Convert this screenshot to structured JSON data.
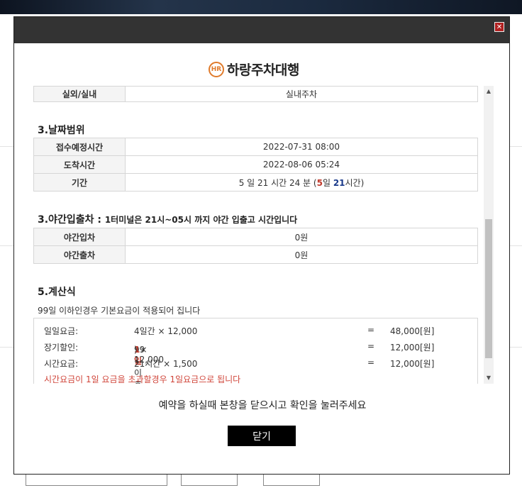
{
  "brand": {
    "logo_mark": "HR",
    "name": "하랑주차대행"
  },
  "colors": {
    "header_bar": "#333333",
    "accent_orange": "#e07a2a",
    "navy": "#1a3a8a",
    "red": "#c0392b",
    "button": "#000000"
  },
  "top_row": {
    "key": "실외/실내",
    "value": "실내주차"
  },
  "section_date": {
    "title": "3.날짜범위",
    "rows": [
      {
        "key": "접수예정시간",
        "value": "2022-07-31 08:00"
      },
      {
        "key": "도착시간",
        "value": "2022-08-06 05:24"
      }
    ],
    "period": {
      "key": "기간",
      "prefix": "5 일 21 시간 24 분 (",
      "days": "5",
      "days_unit": "일 ",
      "hours": "21",
      "hours_unit": "시간",
      "suffix": ")"
    }
  },
  "section_night": {
    "title": "3.야간입출차 :",
    "note": "1터미널은 21시~05시 까지 야간 입출고 시간입니다",
    "rows": [
      {
        "key": "야간입차",
        "value": "0원"
      },
      {
        "key": "야간출차",
        "value": "0원"
      }
    ]
  },
  "section_calc": {
    "title": "5.계산식",
    "note": "99일 이하인경우 기본요금이 적용되어 집니다",
    "rows": [
      {
        "label": "일일요금:",
        "formula": "4일간 × 12,000",
        "eq": "=",
        "result": "48,000[원]"
      },
      {
        "label": "장기할인:",
        "formula_pre": "99일이후(",
        "formula_red": "1일",
        "formula_post": ") × 12,000",
        "eq": "=",
        "result": "12,000[원]"
      },
      {
        "label": "시간요금:",
        "formula": "21시간 × 1,500",
        "eq": "=",
        "result": "12,000[원]"
      }
    ],
    "warning": "시간요금이 1일 요금을 초과할경우 1일요금으로 됩니다"
  },
  "footer": {
    "message": "예약을 하실때 본창을 닫으시고 확인을 눌러주세요",
    "close_label": "닫기",
    "close_icon": "close-x-icon"
  },
  "scrollbar": {
    "up_icon": "▲",
    "down_icon": "▼"
  }
}
